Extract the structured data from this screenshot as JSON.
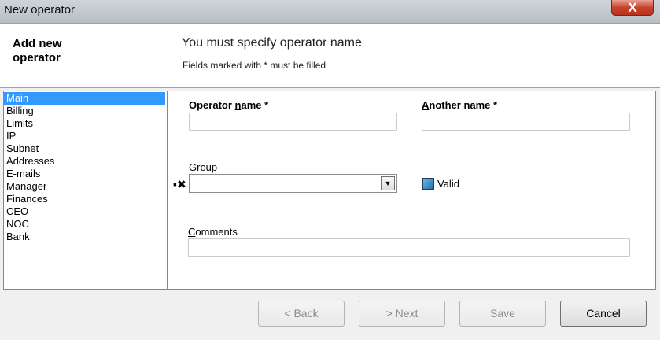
{
  "window": {
    "title": "New operator",
    "close_label": "X"
  },
  "header": {
    "title": "Add new operator",
    "message": "You must specify operator name",
    "hint": "Fields marked with * must be filled"
  },
  "sidebar": {
    "items": [
      {
        "label": "Main",
        "active": true
      },
      {
        "label": "Billing"
      },
      {
        "label": "Limits"
      },
      {
        "label": "IP"
      },
      {
        "label": "Subnet"
      },
      {
        "label": "Addresses"
      },
      {
        "label": "E-mails"
      },
      {
        "label": "Manager"
      },
      {
        "label": "Finances"
      },
      {
        "label": "CEO"
      },
      {
        "label": "NOC"
      },
      {
        "label": "Bank"
      }
    ]
  },
  "form": {
    "operator_name": {
      "label_pre": "Operator ",
      "label_u": "n",
      "label_post": "ame *",
      "value": ""
    },
    "another_name": {
      "label_u": "A",
      "label_post": "nother name *",
      "value": ""
    },
    "group": {
      "label_u": "G",
      "label_post": "roup",
      "value": ""
    },
    "valid": {
      "label": "Valid",
      "checked": true
    },
    "comments": {
      "label_u": "C",
      "label_post": "omments",
      "value": ""
    }
  },
  "buttons": {
    "back": "< Back",
    "next": "> Next",
    "save": "Save",
    "cancel": "Cancel"
  },
  "colors": {
    "selection": "#3399ff",
    "close_button": "#c7432c"
  }
}
